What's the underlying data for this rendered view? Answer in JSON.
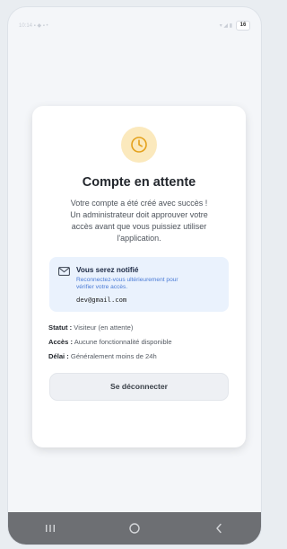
{
  "status_bar": {
    "left_text": "10:14 ▪ ◆ ▪ •",
    "right_text": "▾ ◢ ▮",
    "battery": "16"
  },
  "card": {
    "icon": "clock-icon",
    "title": "Compte en attente",
    "description": "Votre compte a été créé avec succès !\nUn administrateur doit approuver votre\naccès avant que vous puissiez utiliser\nl'application.",
    "notice": {
      "icon": "mail-icon",
      "title": "Vous serez notifié",
      "text": "Reconnectez-vous ultérieurement pour\nvérifier votre accès.",
      "email": "dev@gmail.com"
    },
    "info": [
      {
        "label": "Statut :",
        "value": " Visiteur (en attente)"
      },
      {
        "label": "Accès :",
        "value": " Aucune fonctionnalité disponible"
      },
      {
        "label": "Délai :",
        "value": " Généralement moins de 24h"
      }
    ],
    "logout_label": "Se déconnecter"
  },
  "colors": {
    "accent_amber": "#f0b429",
    "notice_bg": "#eaf2fd",
    "notice_text": "#4a7bd6",
    "navbar": "#6d6f73"
  },
  "navbar": {
    "icons": [
      "recent-apps-icon",
      "home-icon",
      "back-icon"
    ]
  }
}
